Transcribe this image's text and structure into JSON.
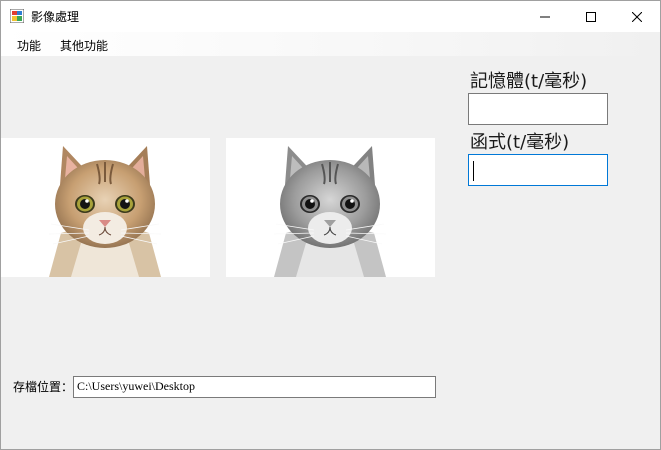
{
  "window": {
    "title": "影像處理",
    "controls": [
      "minimize",
      "maximize",
      "close"
    ]
  },
  "menu": {
    "items": [
      {
        "label": "功能"
      },
      {
        "label": "其他功能"
      }
    ]
  },
  "images": {
    "original": {
      "description_icon": "cat-color-image"
    },
    "processed": {
      "description_icon": "cat-grayscale-image"
    }
  },
  "timings": {
    "memory_label": "記憶體(t/毫秒)",
    "memory_value": "",
    "function_label": "函式(t/毫秒)",
    "function_value": ""
  },
  "save": {
    "label": "存檔位置：",
    "path": "C:\\Users\\yuwei\\Desktop"
  }
}
